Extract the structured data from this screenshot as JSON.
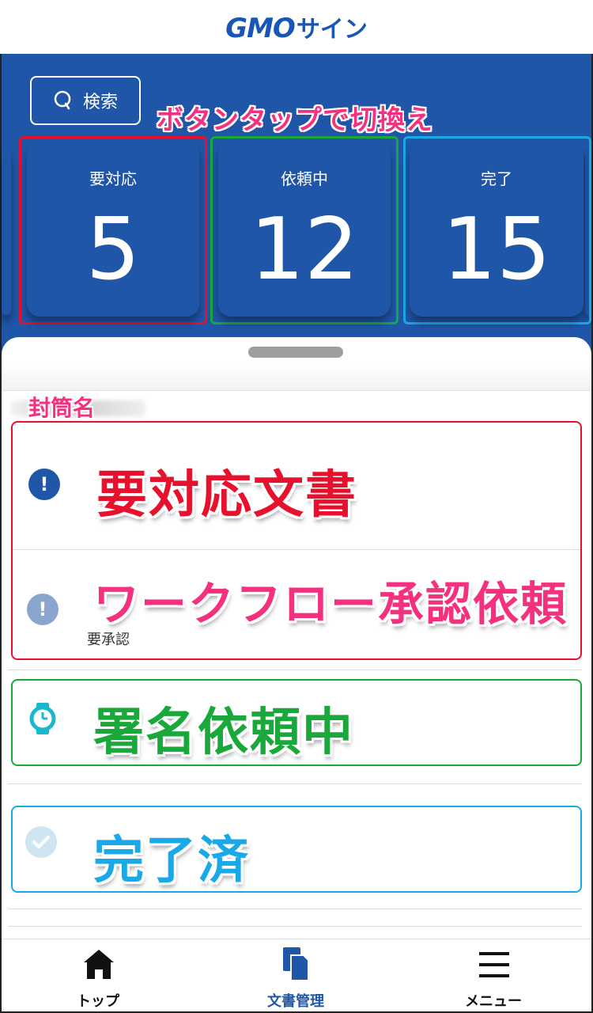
{
  "header": {
    "logo_gmo": "GMO",
    "logo_sign": "サイン"
  },
  "search": {
    "label": "検索"
  },
  "annotation_hint": "ボタンタップで切換え",
  "status_cards": [
    {
      "label": "要対応",
      "count": "5",
      "outline_color": "#e8112d"
    },
    {
      "label": "依頼中",
      "count": "12",
      "outline_color": "#1aa83a"
    },
    {
      "label": "完了",
      "count": "15",
      "outline_color": "#19a9e6"
    }
  ],
  "envelope_label": "封筒名",
  "list": {
    "action_required": {
      "title": "要対応文書",
      "color": "#e8112d",
      "icon": "exclamation-icon"
    },
    "workflow": {
      "title": "ワークフロー承認依頼",
      "subtitle": "要承認",
      "color": "#f5317f",
      "icon": "exclamation-icon"
    },
    "requesting": {
      "title": "署名依頼中",
      "color": "#1aa83a",
      "icon": "watch-icon"
    },
    "completed": {
      "title": "完了済",
      "color": "#19a9e6",
      "icon": "check-icon"
    }
  },
  "bottom_nav": [
    {
      "label": "トップ",
      "icon": "home-icon",
      "active": false
    },
    {
      "label": "文書管理",
      "icon": "documents-icon",
      "active": true
    },
    {
      "label": "メニュー",
      "icon": "menu-icon",
      "active": false
    }
  ],
  "colors": {
    "primary": "#1f56a8",
    "accent_pink": "#f5317f"
  }
}
